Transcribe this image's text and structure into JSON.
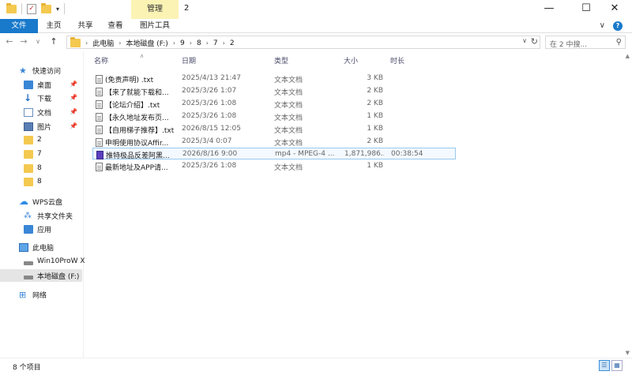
{
  "titlebar": {
    "title": "2",
    "context_tab": "管理",
    "minimize": "—",
    "maximize": "☐",
    "close": "✕"
  },
  "ribbon": {
    "tabs": [
      "文件",
      "主页",
      "共享",
      "查看",
      "图片工具"
    ],
    "expand": "∨",
    "help": "?"
  },
  "address": {
    "back": "←",
    "forward": "→",
    "recent": "∨",
    "up": "↑",
    "crumbs": [
      "此电脑",
      "本地磁盘 (F:)",
      "9",
      "8",
      "7",
      "2"
    ],
    "refresh": "↻"
  },
  "search": {
    "placeholder": "在 2 中搜..."
  },
  "sidebar": {
    "items": [
      {
        "label": "快速访问",
        "icon": "star-icon"
      },
      {
        "label": "桌面",
        "icon": "desktop-icon",
        "pinned": true
      },
      {
        "label": "下载",
        "icon": "download-icon",
        "pinned": true
      },
      {
        "label": "文档",
        "icon": "documents-icon",
        "pinned": true
      },
      {
        "label": "图片",
        "icon": "pictures-icon",
        "pinned": true
      },
      {
        "label": "2",
        "icon": "folder-icon"
      },
      {
        "label": "7",
        "icon": "folder-icon"
      },
      {
        "label": "8",
        "icon": "folder-icon"
      },
      {
        "label": "8",
        "icon": "folder-icon"
      },
      {
        "label": "WPS云盘",
        "icon": "cloud-icon"
      },
      {
        "label": "共享文件夹",
        "icon": "share-icon"
      },
      {
        "label": "应用",
        "icon": "apps-icon"
      },
      {
        "label": "此电脑",
        "icon": "computer-icon"
      },
      {
        "label": "Win10ProW X",
        "icon": "drive-icon"
      },
      {
        "label": "本地磁盘 (F:)",
        "icon": "drive-icon",
        "selected": true
      },
      {
        "label": "网络",
        "icon": "network-icon"
      }
    ]
  },
  "columns": {
    "name": "名称",
    "date": "日期",
    "type": "类型",
    "size": "大小",
    "duration": "时长"
  },
  "files": [
    {
      "name": "(免责声明) .txt",
      "date": "2025/4/13 21:47",
      "type": "文本文档",
      "size": "3 KB",
      "duration": "",
      "icon": "text-file-icon"
    },
    {
      "name": "【来了就能下载和...",
      "date": "2025/3/26 1:07",
      "type": "文本文档",
      "size": "2 KB",
      "duration": "",
      "icon": "text-file-icon"
    },
    {
      "name": "【论坛介绍】.txt",
      "date": "2025/3/26 1:08",
      "type": "文本文档",
      "size": "2 KB",
      "duration": "",
      "icon": "text-file-icon"
    },
    {
      "name": "【永久地址发布页...",
      "date": "2025/3/26 1:08",
      "type": "文本文档",
      "size": "1 KB",
      "duration": "",
      "icon": "text-file-icon"
    },
    {
      "name": "【自用梯子推荐】.txt",
      "date": "2026/8/15 12:05",
      "type": "文本文档",
      "size": "1 KB",
      "duration": "",
      "icon": "text-file-icon"
    },
    {
      "name": "申明使用协议Affir...",
      "date": "2025/3/4 0:07",
      "type": "文本文档",
      "size": "2 KB",
      "duration": "",
      "icon": "text-file-icon"
    },
    {
      "name": "推特极品反差阿黑...",
      "date": "2026/8/16 9:00",
      "type": "mp4 - MPEG-4 ...",
      "size": "1,871,986...",
      "duration": "00:38:54",
      "icon": "video-file-icon"
    },
    {
      "name": "最新地址及APP请...",
      "date": "2025/3/26 1:08",
      "type": "文本文档",
      "size": "1 KB",
      "duration": "",
      "icon": "text-file-icon"
    }
  ],
  "status": {
    "count": "8 个项目"
  }
}
